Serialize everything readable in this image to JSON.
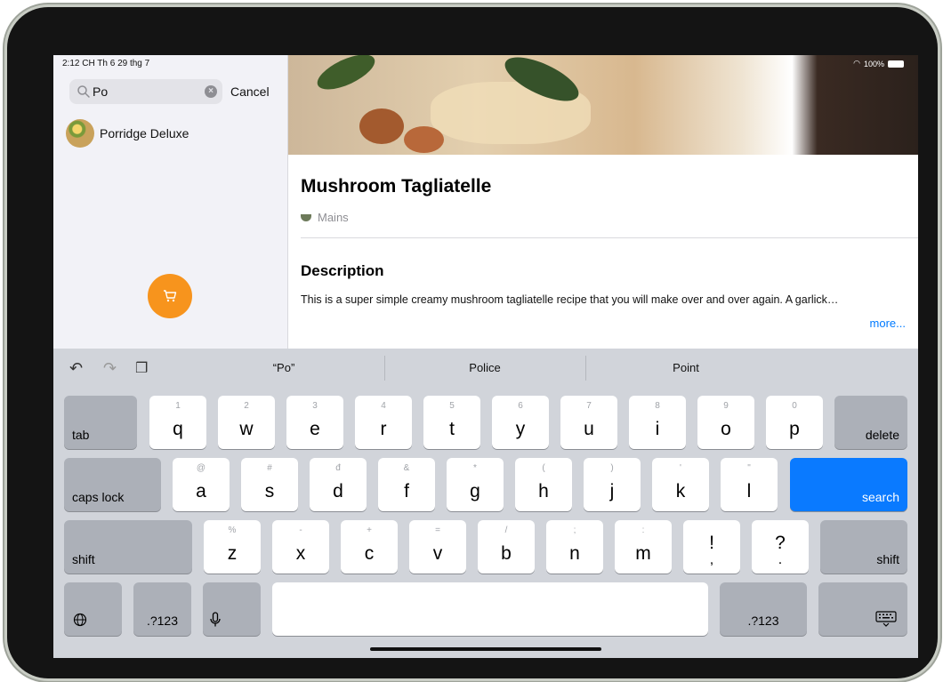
{
  "status_bar": {
    "time_date": "2:12 CH  Th 6 29 thg 7",
    "battery_text": "100%"
  },
  "sidebar": {
    "search": {
      "value": "Po",
      "cancel_label": "Cancel"
    },
    "results": [
      {
        "label": "Porridge Deluxe"
      }
    ]
  },
  "detail": {
    "title": "Mushroom Tagliatelle",
    "category": "Mains",
    "description_heading": "Description",
    "description": "This is a super simple creamy mushroom tagliatelle recipe that you will make over and over again. A garlick…",
    "more_label": "more..."
  },
  "keyboard": {
    "suggestions": [
      "“Po”",
      "Police",
      "Point"
    ],
    "row1": [
      {
        "k": "q",
        "a": "1"
      },
      {
        "k": "w",
        "a": "2"
      },
      {
        "k": "e",
        "a": "3"
      },
      {
        "k": "r",
        "a": "4"
      },
      {
        "k": "t",
        "a": "5"
      },
      {
        "k": "y",
        "a": "6"
      },
      {
        "k": "u",
        "a": "7"
      },
      {
        "k": "i",
        "a": "8"
      },
      {
        "k": "o",
        "a": "9"
      },
      {
        "k": "p",
        "a": "0"
      }
    ],
    "row2": [
      {
        "k": "a",
        "a": "@"
      },
      {
        "k": "s",
        "a": "#"
      },
      {
        "k": "d",
        "a": "đ"
      },
      {
        "k": "f",
        "a": "&"
      },
      {
        "k": "g",
        "a": "*"
      },
      {
        "k": "h",
        "a": "("
      },
      {
        "k": "j",
        "a": ")"
      },
      {
        "k": "k",
        "a": "'"
      },
      {
        "k": "l",
        "a": "\""
      }
    ],
    "row3": [
      {
        "k": "z",
        "a": "%"
      },
      {
        "k": "x",
        "a": "-"
      },
      {
        "k": "c",
        "a": "+"
      },
      {
        "k": "v",
        "a": "="
      },
      {
        "k": "b",
        "a": "/"
      },
      {
        "k": "n",
        "a": ";"
      },
      {
        "k": "m",
        "a": ":"
      },
      {
        "k": "!",
        "a": ""
      },
      {
        "k": "?",
        "a": ""
      }
    ],
    "row3_extra": [
      ",",
      "."
    ],
    "tab_label": "tab",
    "delete_label": "delete",
    "caps_label": "caps lock",
    "search_label": "search",
    "shift_label": "shift",
    "numbers_label": ".?123",
    "accent_color": "#0a7aff"
  }
}
